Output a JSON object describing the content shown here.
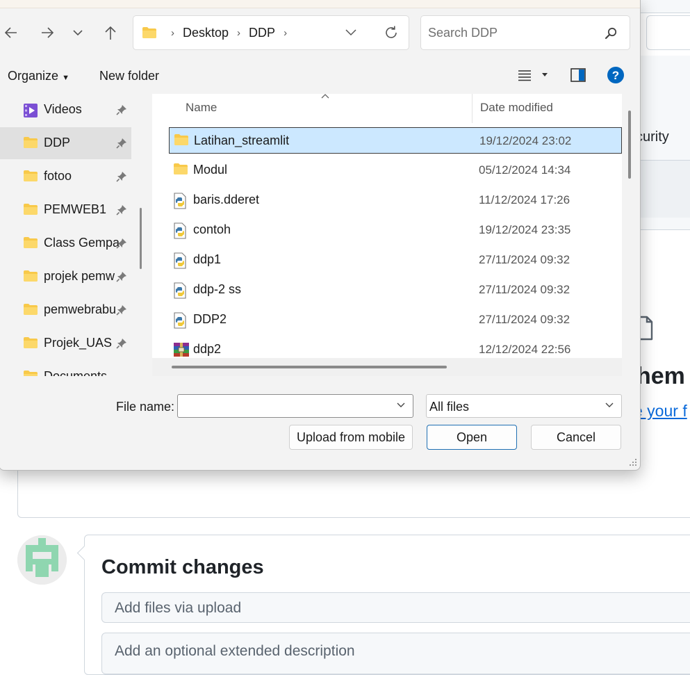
{
  "background_page": {
    "security_tab_text": "curity",
    "drop_heading": "hem",
    "drop_link": "e your f",
    "commit": {
      "title": "Commit changes",
      "summary_placeholder": "Add files via upload",
      "description_placeholder": "Add an optional extended description"
    }
  },
  "dialog": {
    "breadcrumbs": [
      "Desktop",
      "DDP"
    ],
    "search_placeholder": "Search DDP",
    "toolbar": {
      "organize": "Organize",
      "new_folder": "New folder"
    },
    "sidebar": [
      {
        "label": "Videos",
        "icon": "video-folder-icon"
      },
      {
        "label": "DDP",
        "icon": "folder-icon",
        "selected": true
      },
      {
        "label": "fotoo",
        "icon": "folder-icon"
      },
      {
        "label": "PEMWEB1",
        "icon": "folder-icon"
      },
      {
        "label": "Class Gempa",
        "icon": "folder-icon"
      },
      {
        "label": "projek pemw",
        "icon": "folder-icon"
      },
      {
        "label": "pemwebrabu",
        "icon": "folder-icon"
      },
      {
        "label": "Projek_UAS",
        "icon": "folder-icon"
      },
      {
        "label": "Documents",
        "icon": "folder-icon"
      }
    ],
    "columns": {
      "name": "Name",
      "date_modified": "Date modified"
    },
    "files": [
      {
        "name": "Latihan_streamlit",
        "date": "19/12/2024 23:02",
        "type": "folder",
        "selected": true
      },
      {
        "name": "Modul",
        "date": "05/12/2024 14:34",
        "type": "folder"
      },
      {
        "name": "baris.dderet",
        "date": "11/12/2024 17:26",
        "type": "python"
      },
      {
        "name": "contoh",
        "date": "19/12/2024 23:35",
        "type": "python"
      },
      {
        "name": "ddp1",
        "date": "27/11/2024 09:32",
        "type": "python"
      },
      {
        "name": "ddp-2 ss",
        "date": "27/11/2024 09:32",
        "type": "python"
      },
      {
        "name": "DDP2",
        "date": "27/11/2024 09:32",
        "type": "python"
      },
      {
        "name": "ddp2",
        "date": "12/12/2024 22:56",
        "type": "archive"
      }
    ],
    "file_name_label": "File name:",
    "file_name_value": "",
    "file_type": "All files",
    "buttons": {
      "upload_mobile": "Upload from mobile",
      "open": "Open",
      "cancel": "Cancel"
    }
  },
  "colors": {
    "selection": "#cce8ff",
    "accent": "#0067c0",
    "link": "#0969da",
    "folder": "#f8c94a"
  }
}
